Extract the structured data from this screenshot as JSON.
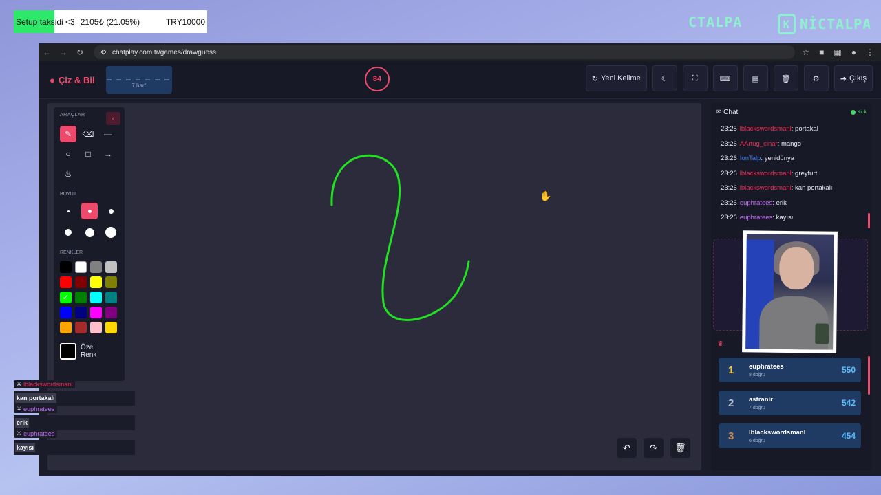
{
  "overlay_top": {
    "donation_title": "Setup taksidi <3",
    "donation_amount": "2105₺ (21.05%)",
    "donation_goal": "TRY10000",
    "brand_1": "CTALPA",
    "brand_2": "NİCTALPA",
    "brand_logo_letter": "K"
  },
  "browser": {
    "url": "chatplay.com.tr/games/drawguess"
  },
  "app": {
    "logo": "Çiz & Bil",
    "word_mask": "_ _ _ _ _ _ _",
    "word_length": "7 harf",
    "timer": "84",
    "header_buttons": {
      "new_word": "Yeni Kelime",
      "exit": "Çıkış"
    }
  },
  "tools": {
    "title": "ARAÇLAR",
    "size_title": "BOYUT",
    "colors_title": "RENKLER",
    "custom_label_1": "Özel",
    "custom_label_2": "Renk",
    "colors": [
      "#000000",
      "#ffffff",
      "#808080",
      "#c0c0c0",
      "#ff0000",
      "#800000",
      "#ffff00",
      "#808000",
      "#00ff00",
      "#008000",
      "#00ffff",
      "#008080",
      "#0000ff",
      "#000080",
      "#ff00ff",
      "#800080",
      "#ffa500",
      "#a52a2a",
      "#ffc0cb",
      "#ffd700"
    ],
    "selected_color": "#00ff00"
  },
  "chat": {
    "title": "Chat",
    "platform": "Kick",
    "messages": [
      {
        "time": "23:25",
        "user": "lblackswordsmanl",
        "text": ": portakal"
      },
      {
        "time": "23:26",
        "user": "AArtug_cinar",
        "text": ": mango"
      },
      {
        "time": "23:26",
        "user": "IonTalp",
        "text": ": yenidünya"
      },
      {
        "time": "23:26",
        "user": "lblackswordsmanl",
        "text": ": greyfurt"
      },
      {
        "time": "23:26",
        "user": "lblackswordsmanl",
        "text": ": kan portakalı"
      },
      {
        "time": "23:26",
        "user": "euphratees",
        "text": ": erik"
      },
      {
        "time": "23:26",
        "user": "euphratees",
        "text": ": kayısı"
      }
    ]
  },
  "leaderboard": [
    {
      "rank": "1",
      "name": "euphratees",
      "sub": "8 doğru",
      "score": "550"
    },
    {
      "rank": "2",
      "name": "astranir",
      "sub": "7 doğru",
      "score": "542"
    },
    {
      "rank": "3",
      "name": "lblackswordsmanl",
      "sub": "6 doğru",
      "score": "454"
    }
  ],
  "stream_chat": [
    {
      "user": "lblackswordsmanl",
      "text": "kan portakalı"
    },
    {
      "user": "euphratees",
      "text": "erik"
    },
    {
      "user": "euphratees",
      "text": "kayısı"
    }
  ]
}
